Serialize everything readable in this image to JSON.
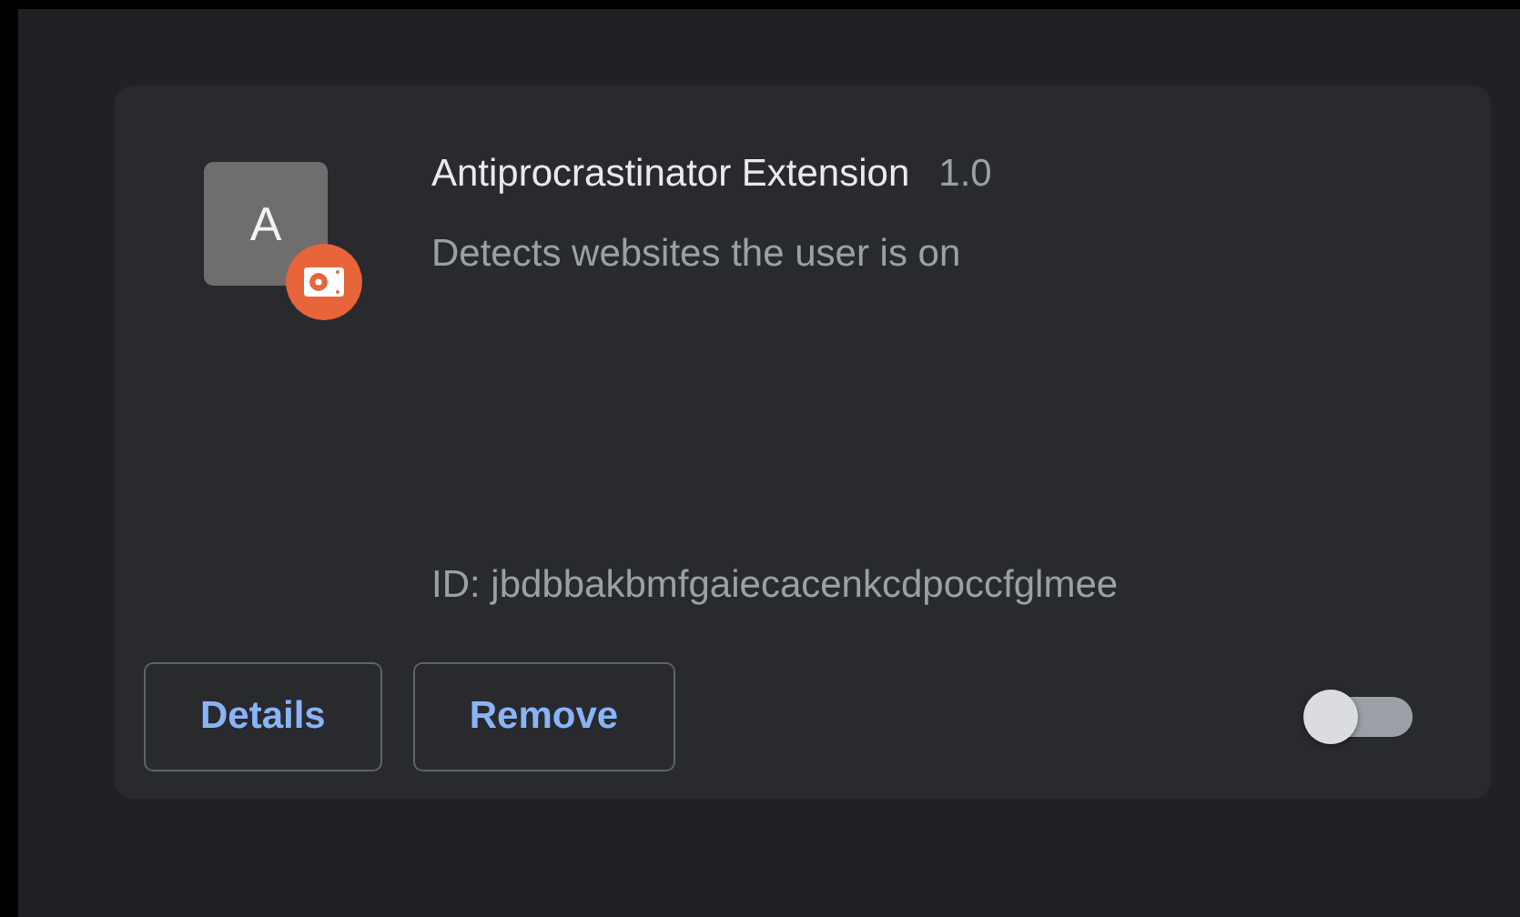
{
  "extension": {
    "icon_letter": "A",
    "name": "Antiprocrastinator Extension",
    "version": "1.0",
    "description": "Detects websites the user is on",
    "id": "ID: jbdbbakbmfgaiecacenkcdpoccfglmee",
    "enabled": false
  },
  "buttons": [
    "Details",
    "Remove"
  ]
}
